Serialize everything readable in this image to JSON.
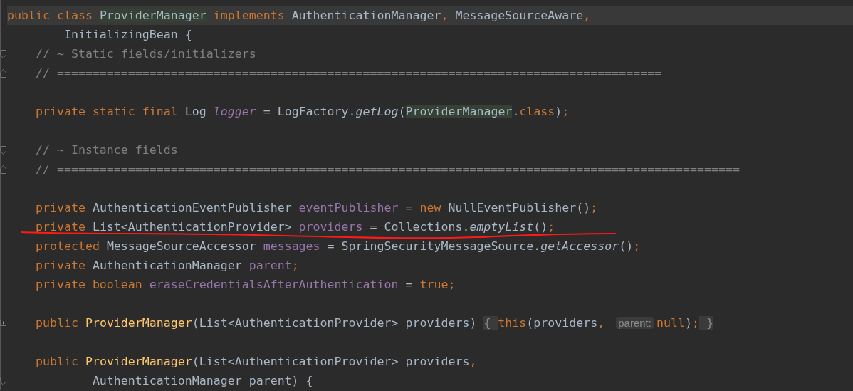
{
  "blocks": [
    {
      "lines": [
        {
          "current": true,
          "tokens": [
            {
              "kind": "kw",
              "text": "public class "
            },
            {
              "kind": "usage",
              "text": "ProviderManager"
            },
            {
              "kind": "kw",
              "text": " implements "
            },
            {
              "kind": "plain",
              "text": "AuthenticationManager"
            },
            {
              "kind": "kw",
              "text": ", "
            },
            {
              "kind": "plain",
              "text": "MessageSourceAware"
            },
            {
              "kind": "kw",
              "text": ","
            }
          ]
        },
        {
          "tokens": [
            {
              "kind": "plain",
              "text": "        InitializingBean {"
            }
          ]
        },
        {
          "fold_open": true,
          "tokens": [
            {
              "kind": "comment",
              "text": "    // ~ Static fields/initializers"
            }
          ]
        },
        {
          "fold_close": true,
          "tokens": [
            {
              "kind": "comment",
              "text": "    // ====================================================================================="
            }
          ]
        }
      ]
    },
    {
      "lines": [
        {
          "tokens": [
            {
              "kind": "kw",
              "text": "    private static final "
            },
            {
              "kind": "plain",
              "text": "Log "
            },
            {
              "kind": "static-field",
              "text": "logger"
            },
            {
              "kind": "plain",
              "text": " = LogFactory."
            },
            {
              "kind": "static-call",
              "text": "getLog"
            },
            {
              "kind": "plain",
              "text": "("
            },
            {
              "kind": "usage",
              "text": "ProviderManager"
            },
            {
              "kind": "plain",
              "text": "."
            },
            {
              "kind": "kw",
              "text": "class"
            },
            {
              "kind": "plain",
              "text": ")"
            },
            {
              "kind": "kw",
              "text": ";"
            }
          ]
        }
      ]
    },
    {
      "lines": [
        {
          "fold_open": true,
          "tokens": [
            {
              "kind": "comment",
              "text": "    // ~ Instance fields"
            }
          ]
        },
        {
          "fold_close": true,
          "tokens": [
            {
              "kind": "comment",
              "text": "    // ================================================================================================"
            }
          ]
        }
      ]
    },
    {
      "lines": [
        {
          "tokens": [
            {
              "kind": "kw",
              "text": "    private "
            },
            {
              "kind": "plain",
              "text": "AuthenticationEventPublisher "
            },
            {
              "kind": "field",
              "text": "eventPublisher"
            },
            {
              "kind": "plain",
              "text": " = "
            },
            {
              "kind": "kw",
              "text": "new "
            },
            {
              "kind": "plain",
              "text": "NullEventPublisher()"
            },
            {
              "kind": "kw",
              "text": ";"
            }
          ]
        },
        {
          "underlined": true,
          "tokens": [
            {
              "kind": "kw",
              "text": "    private "
            },
            {
              "kind": "plain",
              "text": "List<AuthenticationProvider> "
            },
            {
              "kind": "field",
              "text": "providers"
            },
            {
              "kind": "plain",
              "text": " = Collections."
            },
            {
              "kind": "static-call",
              "text": "emptyList"
            },
            {
              "kind": "plain",
              "text": "()"
            },
            {
              "kind": "kw",
              "text": ";"
            }
          ]
        },
        {
          "tokens": [
            {
              "kind": "kw",
              "text": "    protected "
            },
            {
              "kind": "plain",
              "text": "MessageSourceAccessor "
            },
            {
              "kind": "field",
              "text": "messages"
            },
            {
              "kind": "plain",
              "text": " = SpringSecurityMessageSource."
            },
            {
              "kind": "static-call",
              "text": "getAccessor"
            },
            {
              "kind": "plain",
              "text": "()"
            },
            {
              "kind": "kw",
              "text": ";"
            }
          ]
        },
        {
          "tokens": [
            {
              "kind": "kw",
              "text": "    private "
            },
            {
              "kind": "plain",
              "text": "AuthenticationManager "
            },
            {
              "kind": "field",
              "text": "parent"
            },
            {
              "kind": "kw",
              "text": ";"
            }
          ]
        },
        {
          "tokens": [
            {
              "kind": "kw",
              "text": "    private boolean "
            },
            {
              "kind": "field",
              "text": "eraseCredentialsAfterAuthentication"
            },
            {
              "kind": "plain",
              "text": " = "
            },
            {
              "kind": "kw",
              "text": "true;"
            }
          ]
        }
      ]
    },
    {
      "lines": [
        {
          "collapsed": true,
          "tokens": [
            {
              "kind": "kw",
              "text": "    public "
            },
            {
              "kind": "decl",
              "text": "ProviderManager"
            },
            {
              "kind": "plain",
              "text": "(List<AuthenticationProvider> providers) "
            },
            {
              "kind": "folded",
              "text": "{ "
            },
            {
              "kind": "kw",
              "text": "this"
            },
            {
              "kind": "plain",
              "text": "(providers"
            },
            {
              "kind": "kw",
              "text": ", "
            },
            {
              "kind": "hint",
              "text": "parent:"
            },
            {
              "kind": "kw",
              "text": "null"
            },
            {
              "kind": "plain",
              "text": ")"
            },
            {
              "kind": "kw",
              "text": ";"
            },
            {
              "kind": "folded",
              "text": " }"
            }
          ]
        }
      ]
    },
    {
      "lines": [
        {
          "tokens": [
            {
              "kind": "kw",
              "text": "    public "
            },
            {
              "kind": "decl",
              "text": "ProviderManager"
            },
            {
              "kind": "plain",
              "text": "(List<AuthenticationProvider> providers"
            },
            {
              "kind": "kw",
              "text": ","
            }
          ]
        },
        {
          "fold_open": true,
          "tokens": [
            {
              "kind": "plain",
              "text": "            AuthenticationManager parent) {"
            }
          ]
        }
      ]
    }
  ]
}
